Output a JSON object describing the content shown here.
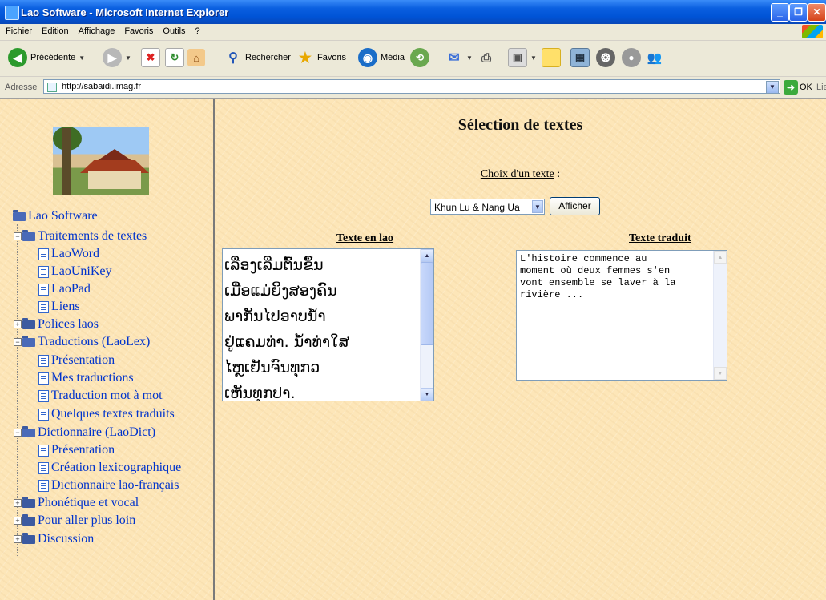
{
  "window": {
    "title": "Lao Software - Microsoft Internet Explorer"
  },
  "menubar": {
    "items": [
      "Fichier",
      "Edition",
      "Affichage",
      "Favoris",
      "Outils",
      "?"
    ]
  },
  "toolbar": {
    "back_label": "Précédente",
    "search_label": "Rechercher",
    "favorites_label": "Favoris",
    "media_label": "Média"
  },
  "addressbar": {
    "label": "Adresse",
    "url": "http://sabaidi.imag.fr",
    "go_label": "OK",
    "links_label": "Liens"
  },
  "nav_tree": {
    "root": "Lao Software",
    "items": [
      "Traitements de textes",
      "LaoWord",
      "LaoUniKey",
      "LaoPad",
      "Liens",
      "Polices laos",
      "Traductions (LaoLex)",
      "Présentation",
      "Mes traductions",
      "Traduction mot à mot",
      "Quelques textes traduits",
      "Dictionnaire (LaoDict)",
      "Présentation",
      "Création lexicographique",
      "Dictionnaire lao-français",
      "Phonétique et vocal",
      "Pour aller plus loin",
      "Discussion"
    ]
  },
  "main": {
    "title": "Sélection de textes",
    "choice_label": "Choix d'un texte",
    "choice_suffix": " :",
    "selected_text": "Khun Lu & Nang Ua",
    "show_button": "Afficher",
    "lao_header": "Texte en lao",
    "translated_header": "Texte traduit",
    "lao_text": "ເລື່ອງເລີ່ມຕົ້ນຂຶ້ນ\nເມື່ອແມ່ຍິງສອງຄົນ\nພາກັນໄປອາບນໍ້າ\nຢູ່ແຄມທ່າ. ນໍ້າທ່າໃສ\nໄຫຼເຢັນຈົນທຸກວ\nເຫັນທຸກປາ.",
    "translated_text": "L'histoire commence au\nmoment où deux femmes s'en\nvont ensemble se laver à la\nrivière ..."
  }
}
